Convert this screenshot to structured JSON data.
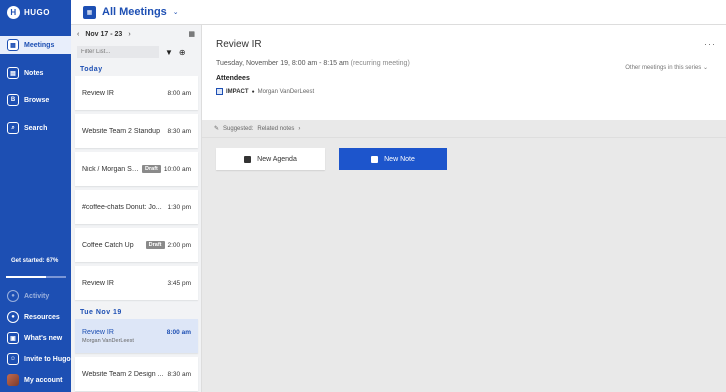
{
  "app": {
    "logo_text": "HUGO"
  },
  "sidebar": {
    "items": [
      {
        "label": "Meetings",
        "icon": "calendar-icon"
      },
      {
        "label": "Notes",
        "icon": "notes-icon"
      },
      {
        "label": "Browse",
        "icon": "browse-icon"
      },
      {
        "label": "Search",
        "icon": "search-icon"
      }
    ],
    "getstarted": "Get started: 67%",
    "progress": 0.67,
    "bottom": [
      {
        "label": "Activity",
        "icon": "activity-icon"
      },
      {
        "label": "Resources",
        "icon": "resources-icon"
      },
      {
        "label": "What's new",
        "icon": "whats-new-icon"
      },
      {
        "label": "Invite to Hugo",
        "icon": "invite-icon"
      },
      {
        "label": "My account",
        "icon": "avatar"
      }
    ]
  },
  "header": {
    "title": "All Meetings"
  },
  "list": {
    "week_range": "Nov 17 - 23",
    "filter_placeholder": "Filter List...",
    "today_label": "Today",
    "tue_label": "Tue Nov 19",
    "today": [
      {
        "title": "Review IR",
        "time": "8:00 am"
      },
      {
        "title": "Website Team 2 Standup",
        "time": "8:30 am"
      },
      {
        "title": "Nick / Morgan Sy...",
        "time": "10:00 am",
        "badge": "Draft"
      },
      {
        "title": "#coffee-chats Donut: Jo...",
        "time": "1:30 pm"
      },
      {
        "title": "Coffee Catch Up",
        "time": "2:00 pm",
        "badge": "Draft"
      },
      {
        "title": "Review IR",
        "time": "3:45 pm"
      }
    ],
    "selected": {
      "title": "Review IR",
      "time": "8:00 am",
      "sub": "Morgan VanDerLeest"
    },
    "after": {
      "title": "Website Team 2 Design ...",
      "time": "8:30 am"
    }
  },
  "detail": {
    "title": "Review IR",
    "when": "Tuesday, November 19, 8:00 am - 8:15 am",
    "recurring": "(recurring meeting)",
    "others": "Other meetings in this series",
    "attendees_label": "Attendees",
    "attendee_org": "IMPACT",
    "attendee_name": "Morgan VanDerLeest",
    "suggested_label": "Suggested:",
    "related_label": "Related notes",
    "new_agenda": "New Agenda",
    "new_note": "New Note"
  }
}
